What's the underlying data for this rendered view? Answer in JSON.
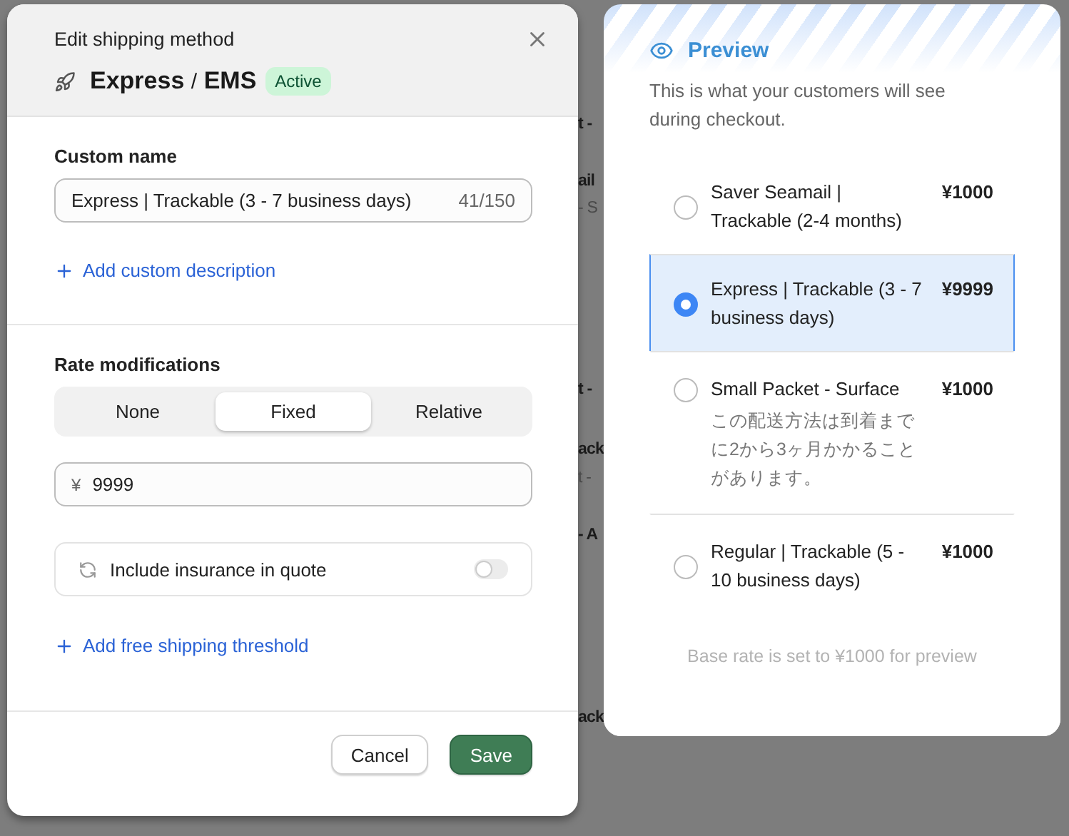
{
  "dialog": {
    "title": "Edit shipping method",
    "method": {
      "name": "Express",
      "separator": "/",
      "carrier": "EMS",
      "status": "Active"
    },
    "custom_name": {
      "label": "Custom name",
      "value": "Express | Trackable (3 - 7 business days)",
      "counter": "41/150"
    },
    "add_description": "Add custom description",
    "rate_modifications": {
      "label": "Rate modifications",
      "options": [
        {
          "label": "None",
          "selected": false
        },
        {
          "label": "Fixed",
          "selected": true
        },
        {
          "label": "Relative",
          "selected": false
        }
      ],
      "currency": "¥",
      "amount": "9999"
    },
    "insurance": {
      "label": "Include insurance in quote",
      "on": false
    },
    "add_threshold": "Add free shipping threshold",
    "buttons": [
      {
        "label": "Cancel",
        "kind": "secondary"
      },
      {
        "label": "Save",
        "kind": "primary"
      }
    ]
  },
  "preview": {
    "title": "Preview",
    "description": "This is what your customers will see during checkout.",
    "options": [
      {
        "name": "Saver Seamail | Trackable (2-4 months)",
        "price": "¥1000",
        "selected": false
      },
      {
        "name": "Express | Trackable (3 - 7 business days)",
        "price": "¥9999",
        "selected": true
      },
      {
        "name": "Small Packet - Surface",
        "price": "¥1000",
        "note": "この配送方法は到着までに2から3ヶ月かかることがあります。",
        "selected": false
      },
      {
        "name": "Regular | Trackable (5 - 10 business days)",
        "price": "¥1000",
        "selected": false
      }
    ],
    "footnote": "Base rate is set to ¥1000 for preview"
  },
  "backdrop": {
    "fragments": [
      {
        "text": "t -",
        "bold": true
      },
      {
        "text": "ail",
        "bold": true
      },
      {
        "text": "- S",
        "bold": false
      },
      {
        "text": "t -",
        "bold": true
      },
      {
        "text": "ack",
        "bold": true
      },
      {
        "text": "t -",
        "bold": false
      },
      {
        "text": "- A",
        "bold": true
      },
      {
        "text": "ack",
        "bold": true
      }
    ]
  }
}
